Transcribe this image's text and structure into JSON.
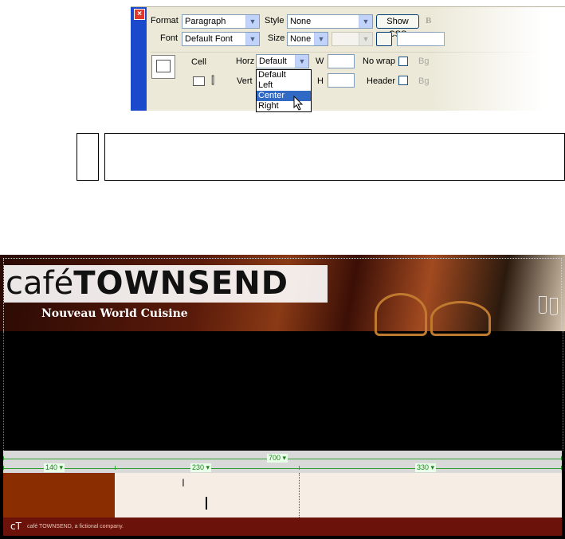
{
  "inspector": {
    "close_icon": "close-x-icon",
    "format_label": "Format",
    "format_value": "Paragraph",
    "style_label": "Style",
    "style_value": "None",
    "show_css_label": "Show CSS",
    "bold_label": "B",
    "font_label": "Font",
    "font_value": "Default Font",
    "size_label": "Size",
    "size_value": "None",
    "cell_label": "Cell",
    "horz_label": "Horz",
    "horz_value": "Default",
    "w_label": "W",
    "nowrap_label": "No wrap",
    "bg_label": "Bg",
    "vert_label": "Vert",
    "h_label": "H",
    "header_label": "Header",
    "bg2_label": "Bg",
    "horz_options": [
      "Default",
      "Left",
      "Center",
      "Right"
    ],
    "horz_highlighted": "Center"
  },
  "page": {
    "logo_light": "café",
    "logo_bold": "TOWNSEND",
    "tagline": "Nouveau World Cuisine",
    "widths": {
      "table": "700",
      "col1": "140",
      "col2": "230",
      "col3": "330"
    },
    "footer_mark": "cT",
    "footer_text": "café TOWNSEND, a fictional company.",
    "colors": {
      "accent_col": "#8a2d00",
      "cell_bg": "#f6eee5",
      "footer_bg": "#6b130b",
      "guide_green": "#2f9f2f"
    }
  }
}
